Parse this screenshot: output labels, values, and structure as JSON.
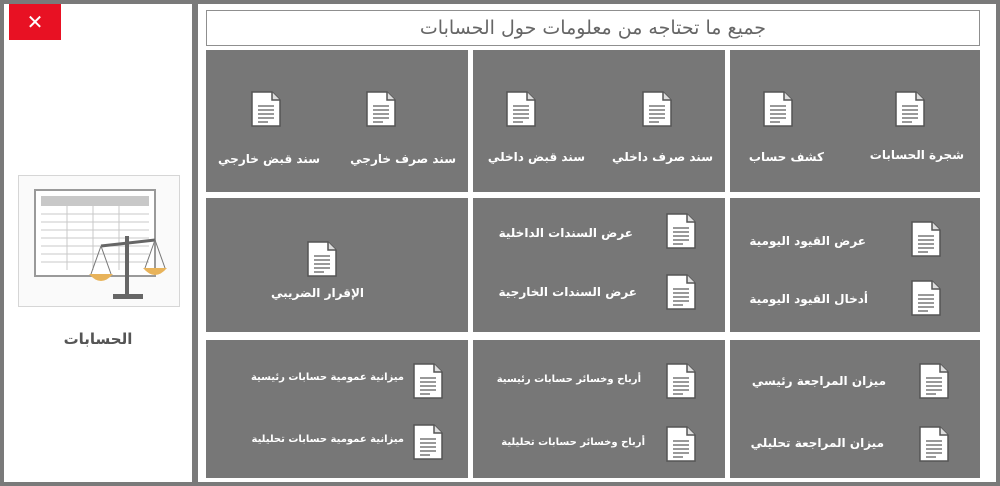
{
  "window": {
    "close_label": "✕"
  },
  "sidebar": {
    "title": "الحسابات"
  },
  "header": {
    "title": "جميع ما تحتاجه من معلومات حول الحسابات"
  },
  "sections": {
    "top_right": {
      "items": [
        "شجرة الحسابات",
        "كشف حساب"
      ]
    },
    "top_center": {
      "items": [
        "سند صرف داخلي",
        "سند قبض داخلي"
      ]
    },
    "top_left": {
      "items": [
        "سند صرف خارجي",
        "سند قبض خارجي"
      ]
    },
    "mid_right": {
      "items": [
        "عرض القيود اليومية",
        "أدخال القيود اليومية"
      ]
    },
    "mid_center": {
      "items": [
        "عرض السندات الداخلية",
        "عرض السندات الخارجية"
      ]
    },
    "mid_left": {
      "items": [
        "الإقرار الضريبي"
      ]
    },
    "bottom_right": {
      "items": [
        "ميزان المراجعة رئيسي",
        "ميزان المراجعة تحليلي"
      ]
    },
    "bottom_center": {
      "items": [
        "أرباح وخسائر حسابات رئيسية",
        "أرباح وخسائر حسابات تحليلية"
      ]
    },
    "bottom_left": {
      "items": [
        "ميزانية عمومية حسابات رئيسية",
        "ميزانية عمومية حسابات تحليلية"
      ]
    }
  },
  "colors": {
    "block": "#777777",
    "close": "#e81123",
    "frame": "#7a7a7a"
  },
  "icons": {
    "document": "document-icon",
    "ledger": "accounting-ledger-scale-icon"
  }
}
